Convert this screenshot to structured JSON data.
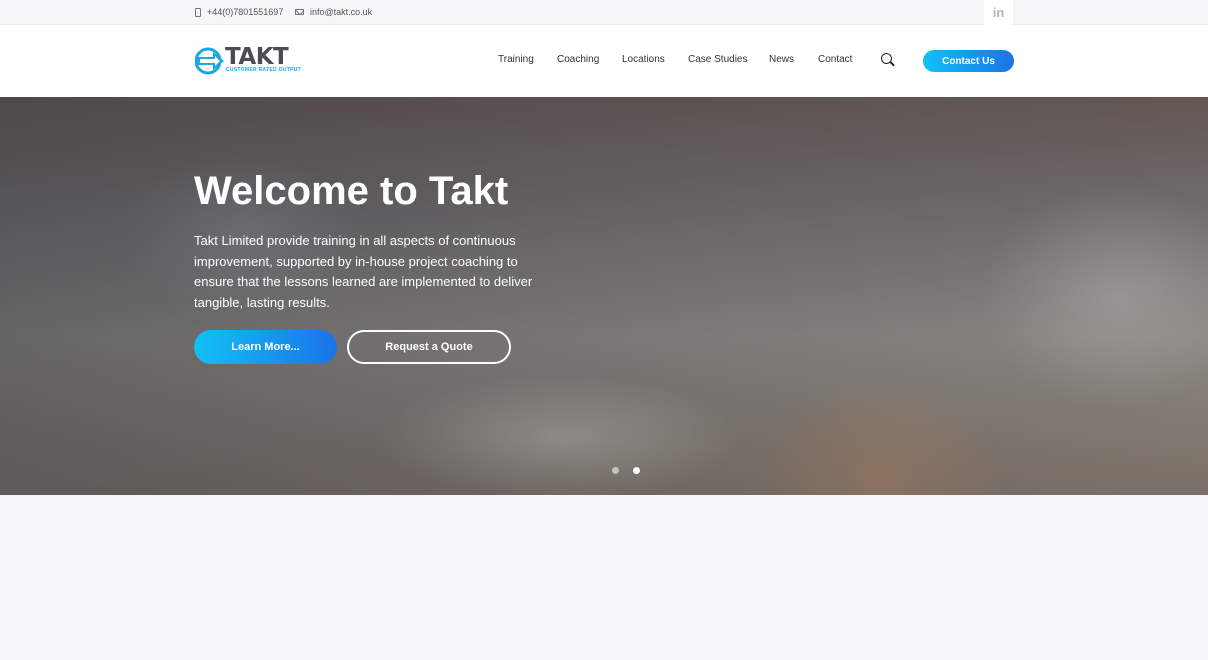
{
  "topbar": {
    "phone": "+44(0)7801551697",
    "email": "info@takt.co.uk",
    "linkedin_label": "in"
  },
  "header": {
    "logo_text": "TAKT",
    "logo_tagline": "CUSTOMER RATED OUTPUT",
    "nav": [
      "Training",
      "Coaching",
      "Locations",
      "Case Studies",
      "News",
      "Contact"
    ],
    "cta_label": "Contact Us"
  },
  "hero": {
    "title": "Welcome to Takt",
    "description": "Takt Limited provide training in all aspects of continuous improvement, supported by in-house project coaching to ensure that the lessons learned are implemented to deliver tangible, lasting results.",
    "primary_button": "Learn More...",
    "secondary_button": "Request a Quote",
    "slides_total": 2,
    "active_slide": 2
  },
  "colors": {
    "accent_start": "#11c1f5",
    "accent_end": "#1b73e8",
    "topbar_bg": "#f5f6f8",
    "logo_blue": "#1aa7e8",
    "logo_gray": "#4a4d52"
  }
}
